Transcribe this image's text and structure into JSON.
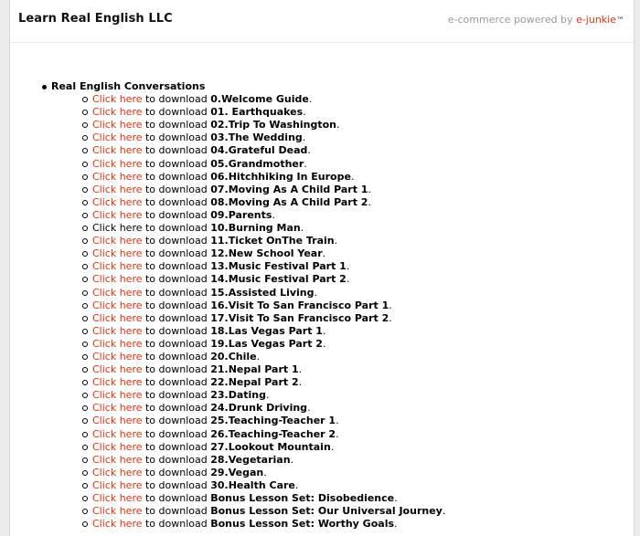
{
  "header": {
    "store_name": "Learn Real English LLC",
    "powered_prefix": "e-commerce powered by ",
    "powered_brand": "e-junkie",
    "powered_tm": "™"
  },
  "section": {
    "title": "Real English Conversations",
    "click_text": "Click here",
    "download_text": " to download ",
    "items": [
      {
        "title": "0.Welcome Guide",
        "suffix": ".",
        "link_red": true
      },
      {
        "title": "01. Earthquakes",
        "suffix": ".",
        "link_red": true
      },
      {
        "title": "02.Trip To Washington",
        "suffix": ".",
        "link_red": true
      },
      {
        "title": "03.The Wedding",
        "suffix": ".",
        "link_red": true
      },
      {
        "title": "04.Grateful Dead",
        "suffix": ".",
        "link_red": true
      },
      {
        "title": "05.Grandmother",
        "suffix": ".",
        "link_red": true
      },
      {
        "title": "06.Hitchhiking In Europe",
        "suffix": ".",
        "link_red": true
      },
      {
        "title": "07.Moving As A Child Part 1",
        "suffix": ".",
        "link_red": true
      },
      {
        "title": "08.Moving As A Child Part 2",
        "suffix": ".",
        "link_red": true
      },
      {
        "title": "09.Parents",
        "suffix": ".",
        "link_red": true
      },
      {
        "title": "10.Burning Man",
        "suffix": ".",
        "link_red": false
      },
      {
        "title": "11.Ticket OnThe Train",
        "suffix": ".",
        "link_red": true
      },
      {
        "title": "12.New School Year",
        "suffix": ".",
        "link_red": true
      },
      {
        "title": "13.Music Festival Part 1",
        "suffix": ".",
        "link_red": true
      },
      {
        "title": "14.Music Festival Part 2",
        "suffix": ".",
        "link_red": true
      },
      {
        "title": "15.Assisted Living",
        "suffix": ".",
        "link_red": true
      },
      {
        "title": "16.Visit To San Francisco Part 1",
        "suffix": ".",
        "link_red": true
      },
      {
        "title": "17.Visit To San Francisco Part 2",
        "suffix": ".",
        "link_red": true
      },
      {
        "title": "18.Las Vegas Part 1",
        "suffix": ".",
        "link_red": true
      },
      {
        "title": "19.Las Vegas Part 2",
        "suffix": ".",
        "link_red": true
      },
      {
        "title": "20.Chile",
        "suffix": ".",
        "link_red": true
      },
      {
        "title": "21.Nepal Part 1",
        "suffix": ".",
        "link_red": true
      },
      {
        "title": "22.Nepal Part 2",
        "suffix": ".",
        "link_red": true
      },
      {
        "title": "23.Dating",
        "suffix": ".",
        "link_red": true
      },
      {
        "title": "24.Drunk Driving",
        "suffix": ".",
        "link_red": true
      },
      {
        "title": "25.Teaching-Teacher 1",
        "suffix": ".",
        "link_red": true
      },
      {
        "title": "26.Teaching-Teacher 2",
        "suffix": ".",
        "link_red": true
      },
      {
        "title": "27.Lookout Mountain",
        "suffix": ".",
        "link_red": true
      },
      {
        "title": "28.Vegetarian",
        "suffix": ".",
        "link_red": true
      },
      {
        "title": "29.Vegan",
        "suffix": ".",
        "link_red": true
      },
      {
        "title": "30.Health Care",
        "suffix": ".",
        "link_red": true
      },
      {
        "title": "Bonus Lesson Set: Disobedience",
        "suffix": ".",
        "link_red": true
      },
      {
        "title": "Bonus Lesson Set: Our Universal Journey",
        "suffix": ".",
        "link_red": true
      },
      {
        "title": "Bonus Lesson Set: Worthy Goals",
        "suffix": ".",
        "link_red": true
      }
    ]
  },
  "colors": {
    "link": "#e03010",
    "background": "#ececec",
    "panel": "#ffffff"
  }
}
